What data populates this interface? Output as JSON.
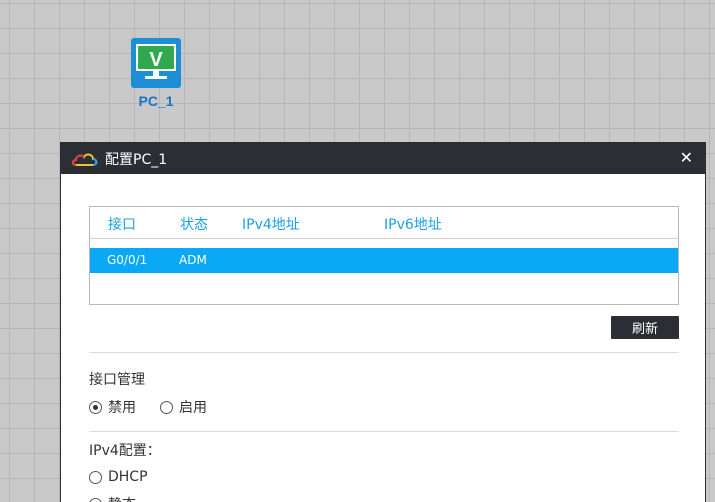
{
  "device": {
    "name": "PC_1",
    "icon": "monitor-v-icon",
    "icon_glyph": "V",
    "icon_color": "#1d8fd6",
    "screen_color": "#2fa84f"
  },
  "dialog": {
    "title": "配置PC_1",
    "title_icon": "cloud-icon",
    "close_glyph": "✕",
    "interfaces": {
      "headers": [
        "接口",
        "状态",
        "IPv4地址",
        "IPv6地址"
      ],
      "rows": [
        {
          "iface": "G0/0/1",
          "status": "ADM",
          "ipv4": "",
          "ipv6": ""
        }
      ]
    },
    "refresh_label": "刷新",
    "interface_mgmt": {
      "label": "接口管理",
      "options": [
        "禁用",
        "启用"
      ],
      "selected": "禁用"
    },
    "ipv4_config": {
      "label": "IPv4配置：",
      "options": [
        "DHCP",
        "静态"
      ],
      "selected": "静态"
    }
  },
  "colors": {
    "accent": "#0aa8f5",
    "header_text": "#1aa0e3",
    "titlebar": "#2b2f35"
  }
}
